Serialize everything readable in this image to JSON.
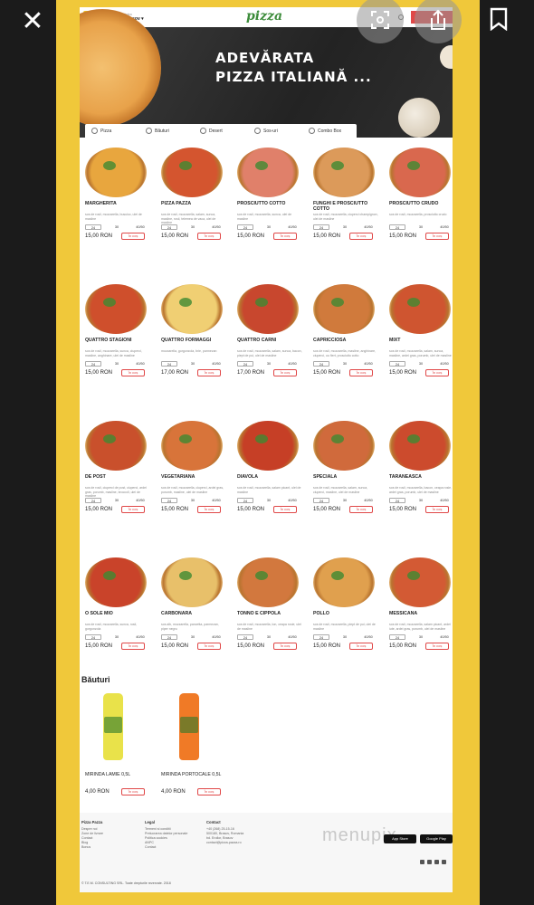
{
  "header": {
    "location_label": "Alege localitatea",
    "location_value": "Poiana Brasov ▾",
    "logo": "pizza"
  },
  "hero": {
    "title": "ADEVĂRATA\nPIZZA ITALIANĂ ..."
  },
  "tabs": [
    "Pizza",
    "Băuturi",
    "Desert",
    "Sos-uri",
    "Combo Box"
  ],
  "add_to_cart_label": "În coș",
  "pizzas": [
    {
      "name": "MARGHERITA",
      "desc": "sos de rosii, mozzarella, busuioc, ulei de masline",
      "sizes": [
        "24",
        "30",
        "40/50"
      ],
      "price": "15,00 RON",
      "color": "#e8a63e"
    },
    {
      "name": "PIZZA PAZZA",
      "desc": "sos de rosii, mozzarella, salam, sunca, masline, rosii, telemea de vaca, ulei de masline",
      "sizes": [
        "24",
        "30",
        "40/50"
      ],
      "price": "15,00 RON",
      "color": "#d4552f"
    },
    {
      "name": "PROSCIUTTO COTTO",
      "desc": "sos de rosii, mozzarella, sunca, ulei de masline",
      "sizes": [
        "24",
        "30",
        "40/50"
      ],
      "price": "15,00 RON",
      "color": "#e0806a"
    },
    {
      "name": "FUNGHI E PROSCIUTTO COTTO",
      "desc": "sos de rosii, mozzarella, ciuperci champignon, ulei de masline",
      "sizes": [
        "24",
        "30",
        "40/50"
      ],
      "price": "15,00 RON",
      "color": "#dc9a5a"
    },
    {
      "name": "PROSCIUTTO CRUDO",
      "desc": "sos de rosii, mozzarella, prosciutto crudo",
      "sizes": [
        "24",
        "30",
        "40/50"
      ],
      "price": "15,00 RON",
      "color": "#d9684e"
    },
    {
      "name": "QUATTRO STAGIONI",
      "desc": "sos de rosii, mozzarella, sunca, ciuperci, masline, anghinare, ulei de masline",
      "sizes": [
        "24",
        "30",
        "40/50"
      ],
      "price": "15,00 RON",
      "color": "#cf4f2c"
    },
    {
      "name": "QUATTRO FORMAGGI",
      "desc": "mozzarella, gorgonzola, brie, parmezan",
      "sizes": [
        "24",
        "30",
        "40/50"
      ],
      "price": "17,00 RON",
      "color": "#f0cf73"
    },
    {
      "name": "QUATTRO CARNI",
      "desc": "sos de rosii, mozzarella, salam, sunca, bacon, piept de pui, ulei de masline",
      "sizes": [
        "24",
        "30",
        "40/50"
      ],
      "price": "17,00 RON",
      "color": "#c8472e"
    },
    {
      "name": "CAPRICCIOSA",
      "desc": "sos de rosii, mozzarella, masline, anghinare, ciuperci, ou fiert, prosciutto cotto",
      "sizes": [
        "24",
        "30",
        "40/50"
      ],
      "price": "15,00 RON",
      "color": "#d07a3c"
    },
    {
      "name": "MIXT",
      "desc": "sos de rosii, mozzarella, salam, sunca, masline, ardei gras, porumb, ulei de masline",
      "sizes": [
        "24",
        "30",
        "40/50"
      ],
      "price": "15,00 RON",
      "color": "#cf5530"
    },
    {
      "name": "DE POST",
      "desc": "sos de rosii, ciuperci de post, ciuperci, ardei gras, porumb, masline, broccoli, ulei de masline",
      "sizes": [
        "24",
        "30",
        "40/50"
      ],
      "price": "15,00 RON",
      "color": "#c9502c"
    },
    {
      "name": "VEGETARIANA",
      "desc": "sos de rosii, mozzarella, ciuperci, ardei gras, porumb, masline, ulei de masline",
      "sizes": [
        "24",
        "30",
        "40/50"
      ],
      "price": "15,00 RON",
      "color": "#d8743a"
    },
    {
      "name": "DIAVOLA",
      "desc": "sos de rosii, mozzarella, salam picant, ulei de masline",
      "sizes": [
        "24",
        "30",
        "40/50"
      ],
      "price": "15,00 RON",
      "color": "#c63f26"
    },
    {
      "name": "SPECIALA",
      "desc": "sos de rosii, mozzarella, salam, sunca, ciuperci, masline, ulei de masline",
      "sizes": [
        "24",
        "30",
        "40/50"
      ],
      "price": "15,00 RON",
      "color": "#d06a3c"
    },
    {
      "name": "TARANEASCA",
      "desc": "sos de rosii, mozzarella, bacon, ceapa rosie, ardei gras, porumb, ulei de masline",
      "sizes": [
        "24",
        "30",
        "40/50"
      ],
      "price": "15,00 RON",
      "color": "#cc4b2d"
    },
    {
      "name": "O SOLE MIO",
      "desc": "sos de rosii, mozzarella, sunca, rosii, gorgonzola",
      "sizes": [
        "24",
        "30",
        "40/50"
      ],
      "price": "15,00 RON",
      "color": "#c9432a"
    },
    {
      "name": "CARBONARA",
      "desc": "sos alb, mozzarella, pancetta, parmezan, piper negru",
      "sizes": [
        "24",
        "30",
        "40/50"
      ],
      "price": "15,00 RON",
      "color": "#e8c06a"
    },
    {
      "name": "TONNO E CIPPOLA",
      "desc": "sos de rosii, mozzarella, ton, ceapa rosie, ulei de masline",
      "sizes": [
        "24",
        "30",
        "40/50"
      ],
      "price": "15,00 RON",
      "color": "#d2783e"
    },
    {
      "name": "POLLO",
      "desc": "sos de rosii, mozzarella, piept de pui, ulei de masline",
      "sizes": [
        "24",
        "30",
        "40/50"
      ],
      "price": "15,00 RON",
      "color": "#e0a04e"
    },
    {
      "name": "MESSICANA",
      "desc": "sos de rosii, mozzarella, salam picant, ardei iute, ardei gras, porumb, ulei de masline",
      "sizes": [
        "24",
        "30",
        "40/50"
      ],
      "price": "15,00 RON",
      "color": "#d35a34"
    }
  ],
  "drinks_title": "Băuturi",
  "drinks": [
    {
      "name": "MIRINDA LAMIE 0,5L",
      "price": "4,00 RON",
      "color": "#e9e24a"
    },
    {
      "name": "MIRINDA PORTOCALE 0,5L",
      "price": "4,00 RON",
      "color": "#f07a26"
    }
  ],
  "footer": {
    "col1": {
      "title": "Pizza Pazza",
      "items": [
        "Despre noi",
        "Zone de livrare",
        "Contact",
        "Blog",
        "Bonus"
      ]
    },
    "col2": {
      "title": "Legal",
      "items": [
        "Termeni si conditii",
        "Prelucrarea datelor personale",
        "Politica cookies",
        "ANPC",
        "Contact"
      ]
    },
    "col3": {
      "title": "Contact",
      "items": [
        "+40 (268) 25-15-16",
        "500180, Brasov, Romania",
        "bd. Eroilor, Brasov",
        "contact@pizza-pazza.ro"
      ]
    },
    "watermark": "menupix",
    "app_store": "App Store",
    "google_play": "Google Play",
    "copyright": "© T.E.M. CONSULTING SRL. Toate drepturile rezervate. 2018"
  },
  "colors": {
    "accent_red": "#e04848",
    "yellow": "#f0c83a",
    "brand_green": "#3d8c3b"
  }
}
